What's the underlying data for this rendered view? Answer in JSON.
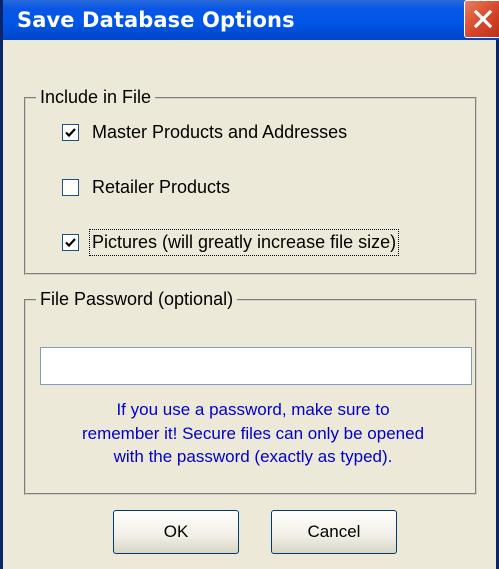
{
  "window": {
    "title": "Save Database Options"
  },
  "include_group": {
    "legend": "Include in File",
    "options": [
      {
        "label": "Master Products and Addresses",
        "checked": true
      },
      {
        "label": "Retailer Products",
        "checked": false
      },
      {
        "label": "Pictures  (will greatly increase file size)",
        "checked": true
      }
    ]
  },
  "password_group": {
    "legend": "File Password  (optional)",
    "value": "",
    "hint_lines": [
      "If you use a password, make sure to",
      "remember it! Secure files can only be opened",
      "with the password (exactly as typed)."
    ]
  },
  "buttons": {
    "ok": "OK",
    "cancel": "Cancel"
  },
  "colors": {
    "title_bar": "#0055e5",
    "close_button": "#d5452a",
    "hint_text": "#0000c8",
    "dialog_bg": "#ece9d8"
  }
}
